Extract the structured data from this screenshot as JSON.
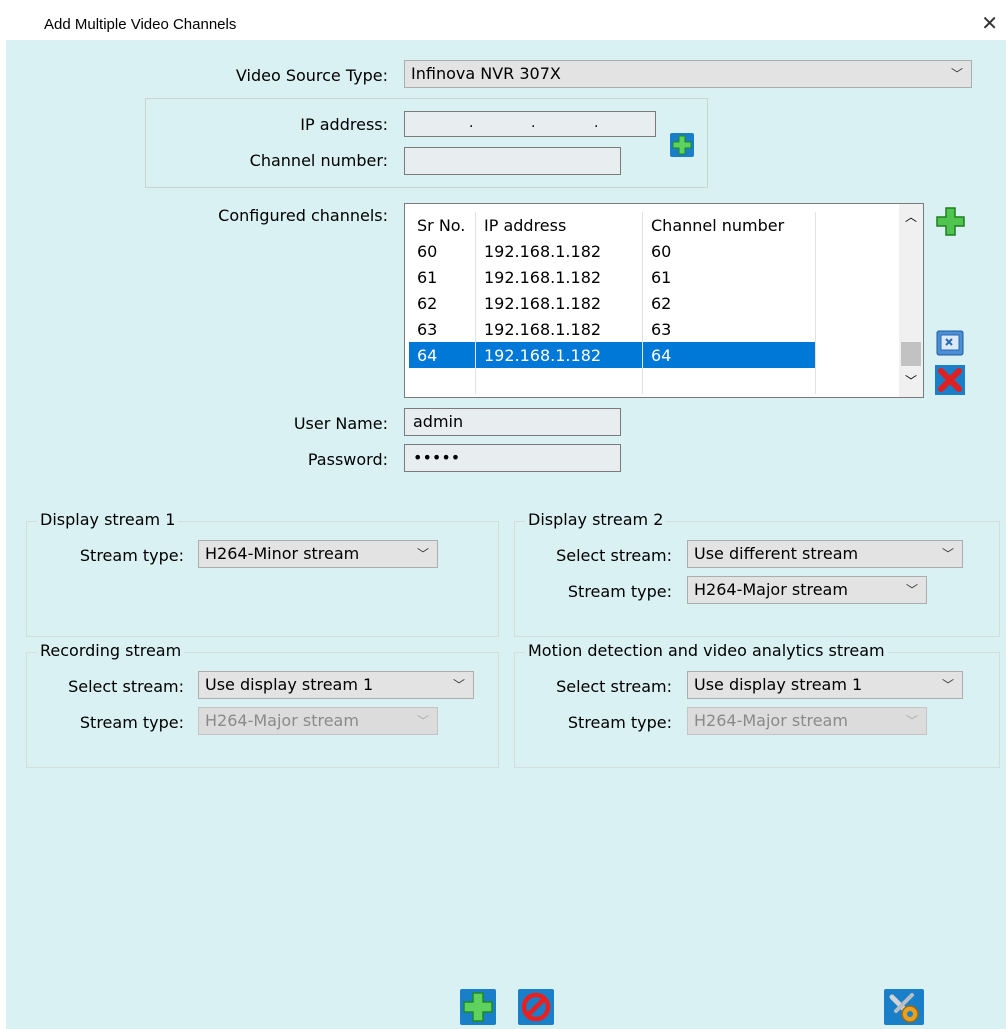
{
  "window": {
    "title": "Add Multiple Video Channels"
  },
  "video_source": {
    "label": "Video Source Type:",
    "value": "Infinova NVR 307X"
  },
  "ip_section": {
    "ip_label": "IP address:",
    "ip_octets": [
      "",
      "",
      "",
      ""
    ],
    "channel_label": "Channel number:",
    "channel_value": ""
  },
  "configured": {
    "label": "Configured channels:",
    "columns": [
      "Sr No.",
      "IP address",
      "Channel number"
    ],
    "rows": [
      [
        "60",
        "192.168.1.182",
        "60"
      ],
      [
        "61",
        "192.168.1.182",
        "61"
      ],
      [
        "62",
        "192.168.1.182",
        "62"
      ],
      [
        "63",
        "192.168.1.182",
        "63"
      ],
      [
        "64",
        "192.168.1.182",
        "64"
      ]
    ],
    "selected_index": 4
  },
  "credentials": {
    "user_label": "User Name:",
    "user_value": "admin",
    "password_label": "Password:",
    "password_value": "•••••"
  },
  "display_stream_1": {
    "title": "Display stream 1",
    "stream_type_label": "Stream type:",
    "stream_type_value": "H264-Minor stream"
  },
  "display_stream_2": {
    "title": "Display stream 2",
    "select_label": "Select stream:",
    "select_value": "Use different stream",
    "stream_type_label": "Stream type:",
    "stream_type_value": "H264-Major stream"
  },
  "recording_stream": {
    "title": "Recording stream",
    "select_label": "Select stream:",
    "select_value": "Use display stream 1",
    "stream_type_label": "Stream type:",
    "stream_type_value": "H264-Major stream"
  },
  "motion_stream": {
    "title": "Motion detection and video analytics stream",
    "select_label": "Select stream:",
    "select_value": "Use display stream 1",
    "stream_type_label": "Stream type:",
    "stream_type_value": "H264-Major stream"
  },
  "icons": {
    "add": "plus-icon",
    "edit": "edit-icon",
    "delete": "delete-icon",
    "cancel": "cancel-icon",
    "settings": "tools-settings-icon"
  },
  "colors": {
    "background": "#d9f1f2",
    "selection": "#0078d7",
    "plus_green": "#3cb43c",
    "delete_red": "#e02020"
  }
}
